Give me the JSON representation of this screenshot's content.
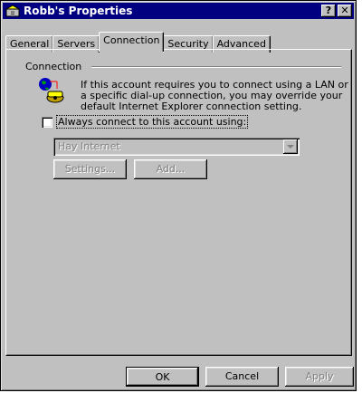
{
  "window": {
    "title": "Robb's Properties",
    "help_label": "?",
    "close_label": "✕"
  },
  "tabs": [
    {
      "label": "General"
    },
    {
      "label": "Servers"
    },
    {
      "label": "Connection"
    },
    {
      "label": "Security"
    },
    {
      "label": "Advanced"
    }
  ],
  "connection": {
    "group_label": "Connection",
    "description": "If this account requires you to connect using a LAN or a specific dial-up connection, you may override your default Internet Explorer connection setting.",
    "checkbox_label": "Always connect to this account using:",
    "checkbox_checked": false,
    "dialup_value": "Hay Internet",
    "settings_label": "Settings...",
    "add_label": "Add..."
  },
  "footer": {
    "ok_label": "OK",
    "cancel_label": "Cancel",
    "apply_label": "Apply"
  }
}
